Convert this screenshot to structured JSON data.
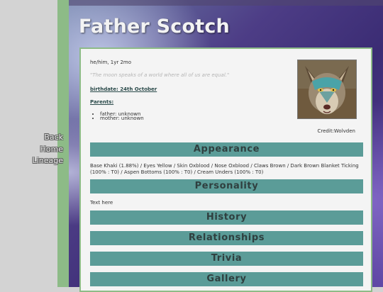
{
  "nav": {
    "back": "Back",
    "home": "Home",
    "lineage": "Lineage"
  },
  "page": {
    "title": "Father Scotch"
  },
  "profile": {
    "pronouns_age": "he/him, 1yr 2mo",
    "quote": "\"The moon speaks of a world where all of us are equal.\"",
    "birthdate": "birthdate: 24th October",
    "parents_heading": "Parents:",
    "parents": [
      "father: unknown",
      "mother: unknown"
    ],
    "credit": "Credit:Wolvden"
  },
  "sections": {
    "appearance": "Appearance",
    "personality": "Personality",
    "history": "History",
    "relationships": "Relationships",
    "trivia": "Trivia",
    "gallery": "Gallery"
  },
  "appearance_text": "Base Khaki (1.88%) / Eyes Yellow / Skin Oxblood / Nose Oxblood / Claws Brown / Dark Brown Blanket Ticking (100% : T0) / Aspen Bottoms (100% : T0) / Cream Unders (100% : T0)",
  "personality_text": "Text here",
  "colors": {
    "accent_green": "#8dbb87",
    "section_header_teal": "#5b9c98",
    "background_purple": "#4d3d86"
  },
  "icons": {
    "portrait": "wolf-portrait"
  }
}
